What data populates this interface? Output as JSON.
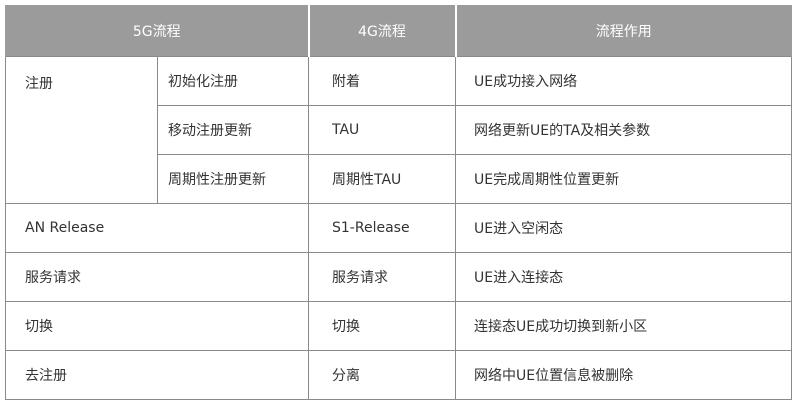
{
  "table": {
    "headers": [
      "5G流程",
      "4G流程",
      "流程作用"
    ],
    "register": {
      "group": "注册",
      "rows": [
        {
          "sub": "初始化注册",
          "g4": "附着",
          "purpose": "UE成功接入网络"
        },
        {
          "sub": "移动注册更新",
          "g4": "TAU",
          "purpose": "网络更新UE的TA及相关参数"
        },
        {
          "sub": "周期性注册更新",
          "g4": "周期性TAU",
          "purpose": "UE完成周期性位置更新"
        }
      ]
    },
    "rows": [
      {
        "g5": "AN Release",
        "g4": "S1-Release",
        "purpose": "UE进入空闲态"
      },
      {
        "g5": "服务请求",
        "g4": "服务请求",
        "purpose": "UE进入连接态"
      },
      {
        "g5": "切换",
        "g4": "切换",
        "purpose": "连接态UE成功切换到新小区"
      },
      {
        "g5": "去注册",
        "g4": "分离",
        "purpose": "网络中UE位置信息被删除"
      }
    ]
  }
}
